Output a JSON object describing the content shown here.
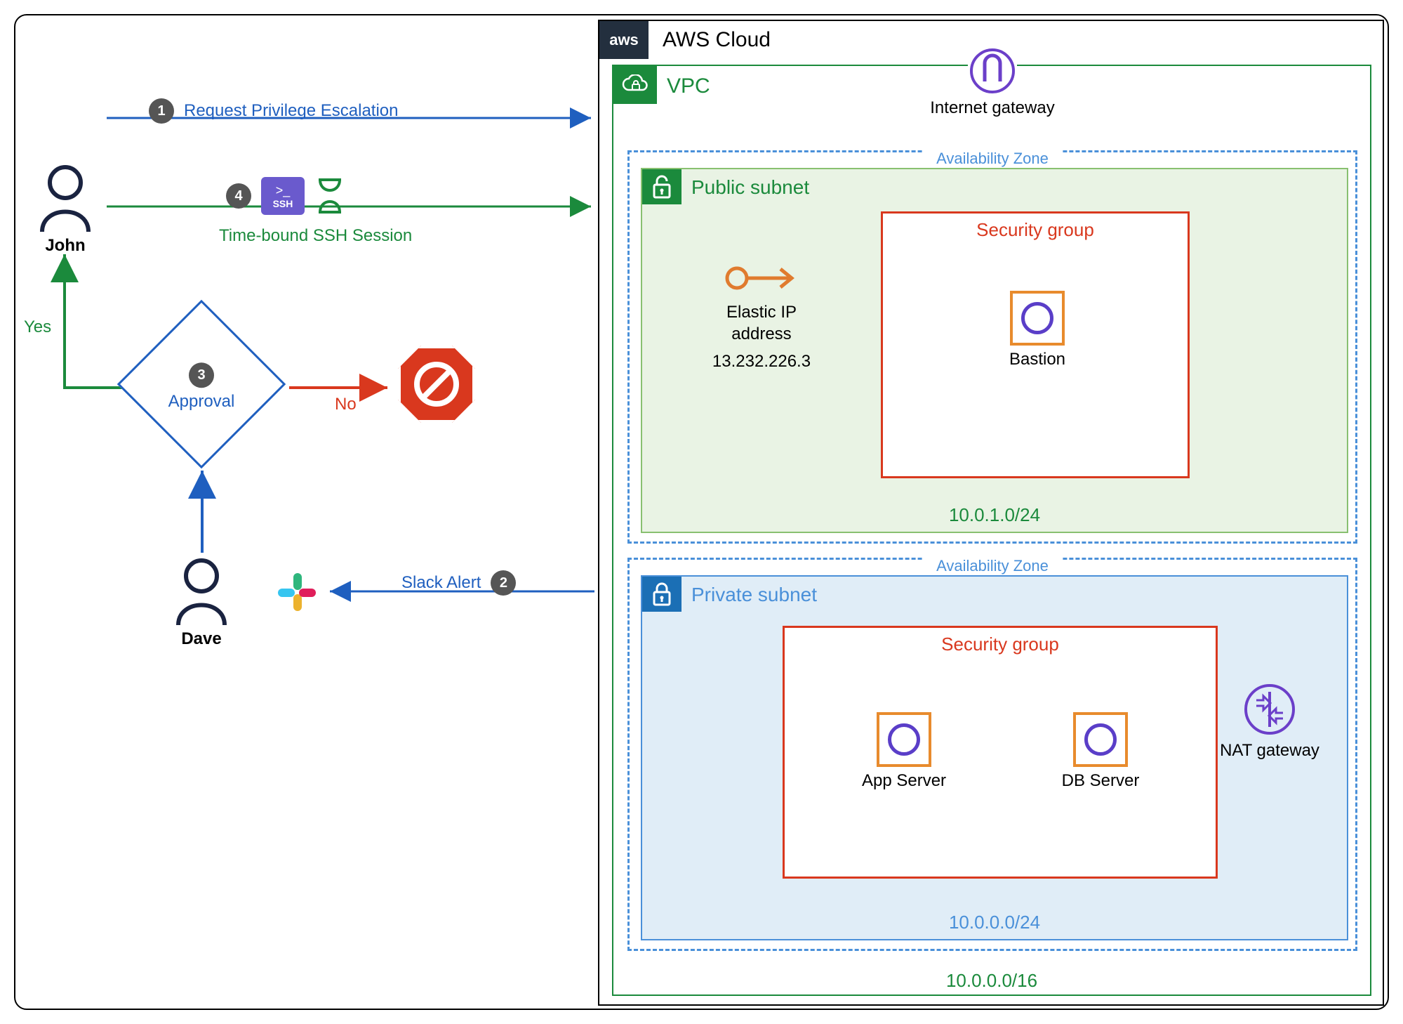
{
  "cloud": {
    "title": "AWS Cloud",
    "badge": "aws"
  },
  "vpc": {
    "title": "VPC",
    "cidr": "10.0.0.0/16"
  },
  "igw": {
    "label": "Internet gateway"
  },
  "az_label": "Availability Zone",
  "public_subnet": {
    "title": "Public subnet",
    "cidr": "10.0.1.0/24",
    "sg_title": "Security group",
    "eip": {
      "label": "Elastic IP\naddress",
      "value": "13.232.226.3"
    },
    "bastion": "Bastion"
  },
  "private_subnet": {
    "title": "Private subnet",
    "cidr": "10.0.0.0/24",
    "sg_title": "Security group",
    "app": "App Server",
    "db": "DB Server",
    "nat": "NAT gateway"
  },
  "actors": {
    "john": "John",
    "dave": "Dave"
  },
  "steps": {
    "s1": {
      "n": "1",
      "text": "Request Privilege Escalation"
    },
    "s2": {
      "n": "2",
      "text": "Slack Alert"
    },
    "s3": {
      "n": "3",
      "text": "Approval"
    },
    "s4": {
      "n": "4",
      "text": "Time-bound SSH Session",
      "ssh": "SSH"
    }
  },
  "decision": {
    "yes": "Yes",
    "no": "No"
  }
}
